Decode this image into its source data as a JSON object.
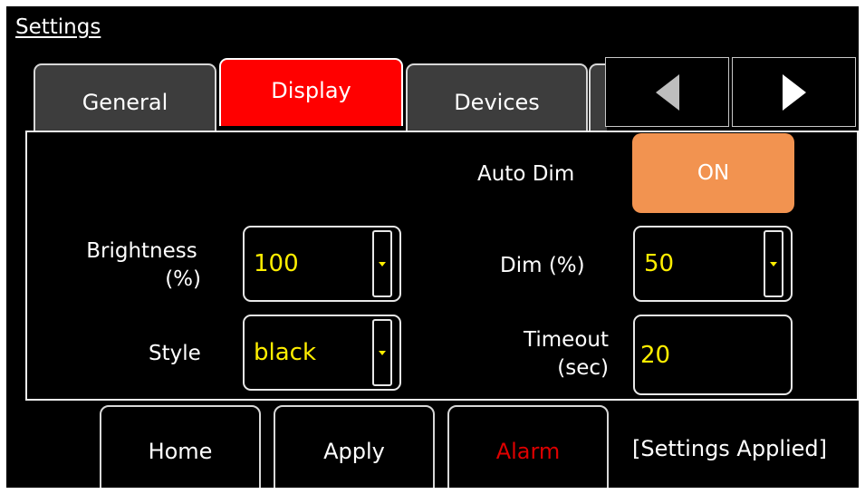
{
  "window": {
    "title": "Settings"
  },
  "tabs": [
    {
      "label": "General",
      "active": false
    },
    {
      "label": "Display",
      "active": true
    },
    {
      "label": "Devices",
      "active": false
    }
  ],
  "tab_scroll": {
    "prev_icon": "triangle-left-icon",
    "next_icon": "triangle-right-icon"
  },
  "display": {
    "auto_dim_label": "Auto Dim",
    "auto_dim_value": "ON",
    "brightness_label_line1": "Brightness",
    "brightness_label_line2": "(%)",
    "brightness_value": "100",
    "style_label": "Style",
    "style_value": "black",
    "dim_label": "Dim (%)",
    "dim_value": "50",
    "timeout_label_line1": "Timeout",
    "timeout_label_line2": "(sec)",
    "timeout_value": "20"
  },
  "footer": {
    "home_label": "Home",
    "apply_label": "Apply",
    "alarm_label": "Alarm",
    "status_text": "[Settings Applied]"
  },
  "colors": {
    "background": "#000000",
    "active_tab": "#ff0000",
    "inactive_tab": "#3d3d3d",
    "toggle_on": "#f29350",
    "value_text": "#ffee00",
    "alarm_text": "#dd0000",
    "arrow_left": "#bdbdbd",
    "arrow_right": "#ffffff"
  }
}
